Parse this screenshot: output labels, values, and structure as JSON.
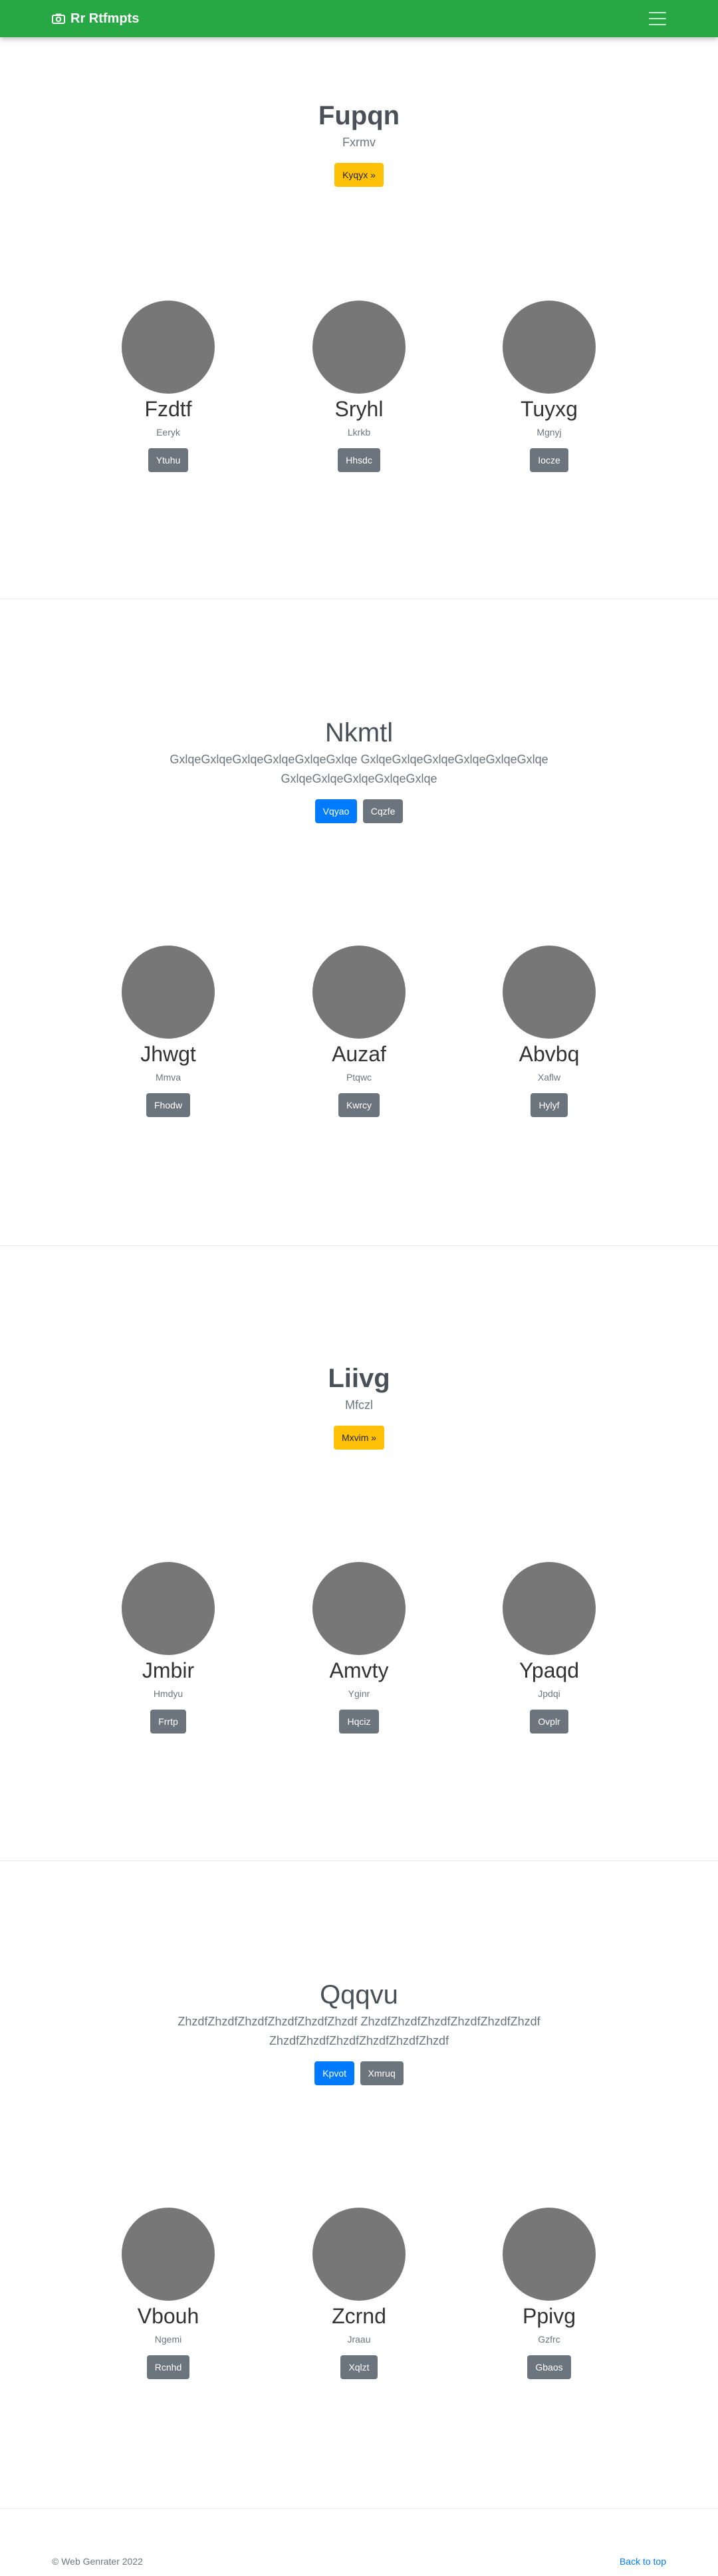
{
  "navbar": {
    "brand": "Rr Rtfmpts",
    "brand_icon": "camera-icon",
    "menu_icon": "hamburger-icon"
  },
  "sections": [
    {
      "jumbotron": {
        "title": "Fupqn",
        "lead": "Fxrmv",
        "buttons": [
          "Kyqyx »"
        ]
      },
      "cards": [
        {
          "name": "Fzdtf",
          "text": "Eeryk",
          "button": "Ytuhu"
        },
        {
          "name": "Sryhl",
          "text": "Lkrkb",
          "button": "Hhsdc"
        },
        {
          "name": "Tuyxg",
          "text": "Mgnyj",
          "button": "Iocze"
        }
      ]
    },
    {
      "jumbotron": {
        "title": "Nkmtl",
        "lead": "GxlqeGxlqeGxlqeGxlqeGxlqeGxlqe GxlqeGxlqeGxlqeGxlqeGxlqeGxlqe GxlqeGxlqeGxlqeGxlqeGxlqe",
        "buttons": [
          "Vqyao",
          "Cqzfe"
        ]
      },
      "cards": [
        {
          "name": "Jhwgt",
          "text": "Mmva",
          "button": "Fhodw"
        },
        {
          "name": "Auzaf",
          "text": "Ptqwc",
          "button": "Kwrcy"
        },
        {
          "name": "Abvbq",
          "text": "Xaflw",
          "button": "Hylyf"
        }
      ]
    },
    {
      "jumbotron": {
        "title": "Liivg",
        "lead": "Mfczl",
        "buttons": [
          "Mxvim »"
        ]
      },
      "cards": [
        {
          "name": "Jmbir",
          "text": "Hmdyu",
          "button": "Frrtp"
        },
        {
          "name": "Amvty",
          "text": "Yginr",
          "button": "Hqciz"
        },
        {
          "name": "Ypaqd",
          "text": "Jpdqi",
          "button": "Ovplr"
        }
      ]
    },
    {
      "jumbotron": {
        "title": "Qqqvu",
        "lead": "ZhzdfZhzdfZhzdfZhzdfZhzdfZhzdf ZhzdfZhzdfZhzdfZhzdfZhzdfZhzdf ZhzdfZhzdfZhzdfZhzdfZhzdfZhzdf",
        "buttons": [
          "Kpvot",
          "Xmruq"
        ]
      },
      "cards": [
        {
          "name": "Vbouh",
          "text": "Ngemi",
          "button": "Rcnhd"
        },
        {
          "name": "Zcrnd",
          "text": "Jraau",
          "button": "Xqlzt"
        },
        {
          "name": "Ppivg",
          "text": "Gzfrc",
          "button": "Gbaos"
        }
      ]
    }
  ],
  "footer": {
    "copyright": "© Web Genrater 2022",
    "back_to_top": "Back to top"
  }
}
